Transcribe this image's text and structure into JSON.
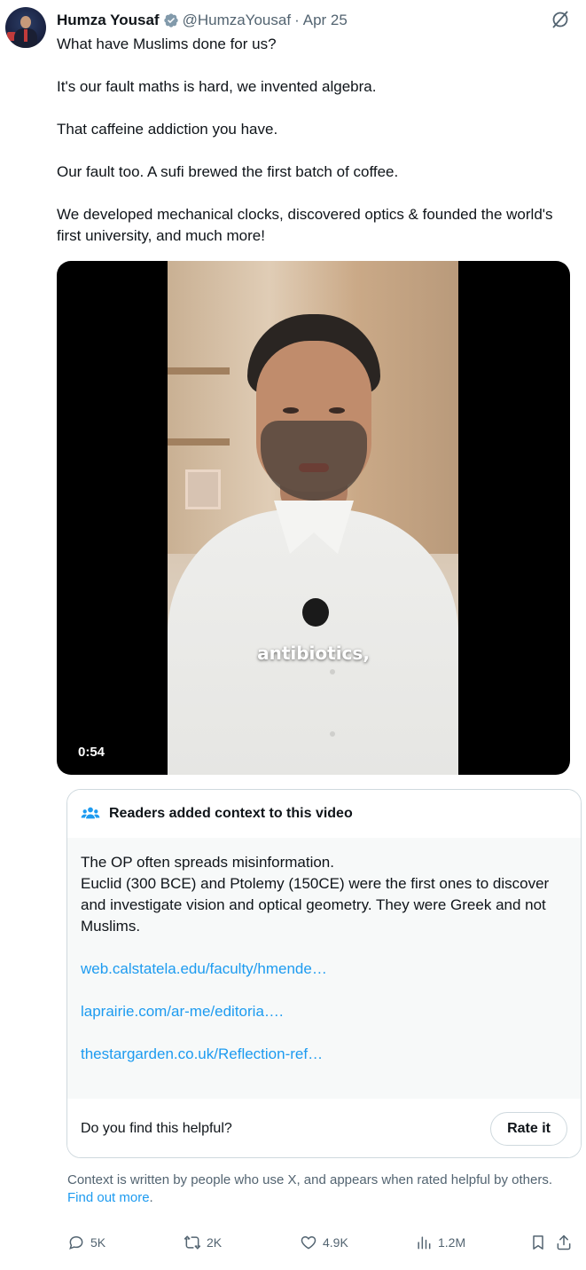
{
  "author": {
    "name": "Humza Yousaf",
    "handle": "@HumzaYousaf",
    "separator": "·",
    "date": "Apr 25"
  },
  "tweet": {
    "paragraphs": [
      "What have Muslims done for us?",
      "It's our fault maths is hard, we invented algebra.",
      "That caffeine addiction you have.",
      "Our fault too. A sufi brewed the first batch of coffee.",
      "We developed mechanical clocks, discovered optics & founded the world's first university, and much more!"
    ]
  },
  "video": {
    "caption": "antibiotics,",
    "duration": "0:54"
  },
  "community_note": {
    "title": "Readers added context to this video",
    "text_lines": [
      "The OP often spreads misinformation.",
      "Euclid (300 BCE) and Ptolemy (150CE) were the first ones to discover and investigate vision and optical geometry. They were Greek and not Muslims."
    ],
    "links": [
      "web.calstatela.edu/faculty/hmende…",
      "laprairie.com/ar-me/editoria….",
      "thestargarden.co.uk/Reflection-ref…"
    ],
    "helpful_prompt": "Do you find this helpful?",
    "rate_label": "Rate it"
  },
  "disclaimer": {
    "text": "Context is written by people who use X, and appears when rated helpful by others.",
    "link": "Find out more",
    "suffix": "."
  },
  "actions": {
    "replies": "5K",
    "reposts": "2K",
    "likes": "4.9K",
    "views": "1.2M"
  },
  "colors": {
    "accent": "#1d9bf0",
    "secondary_text": "#536471",
    "verified_badge": "#829aab"
  },
  "icons": [
    "verified-icon",
    "grok-icon",
    "people-icon",
    "reply-icon",
    "repost-icon",
    "like-icon",
    "views-icon",
    "bookmark-icon",
    "share-icon"
  ]
}
